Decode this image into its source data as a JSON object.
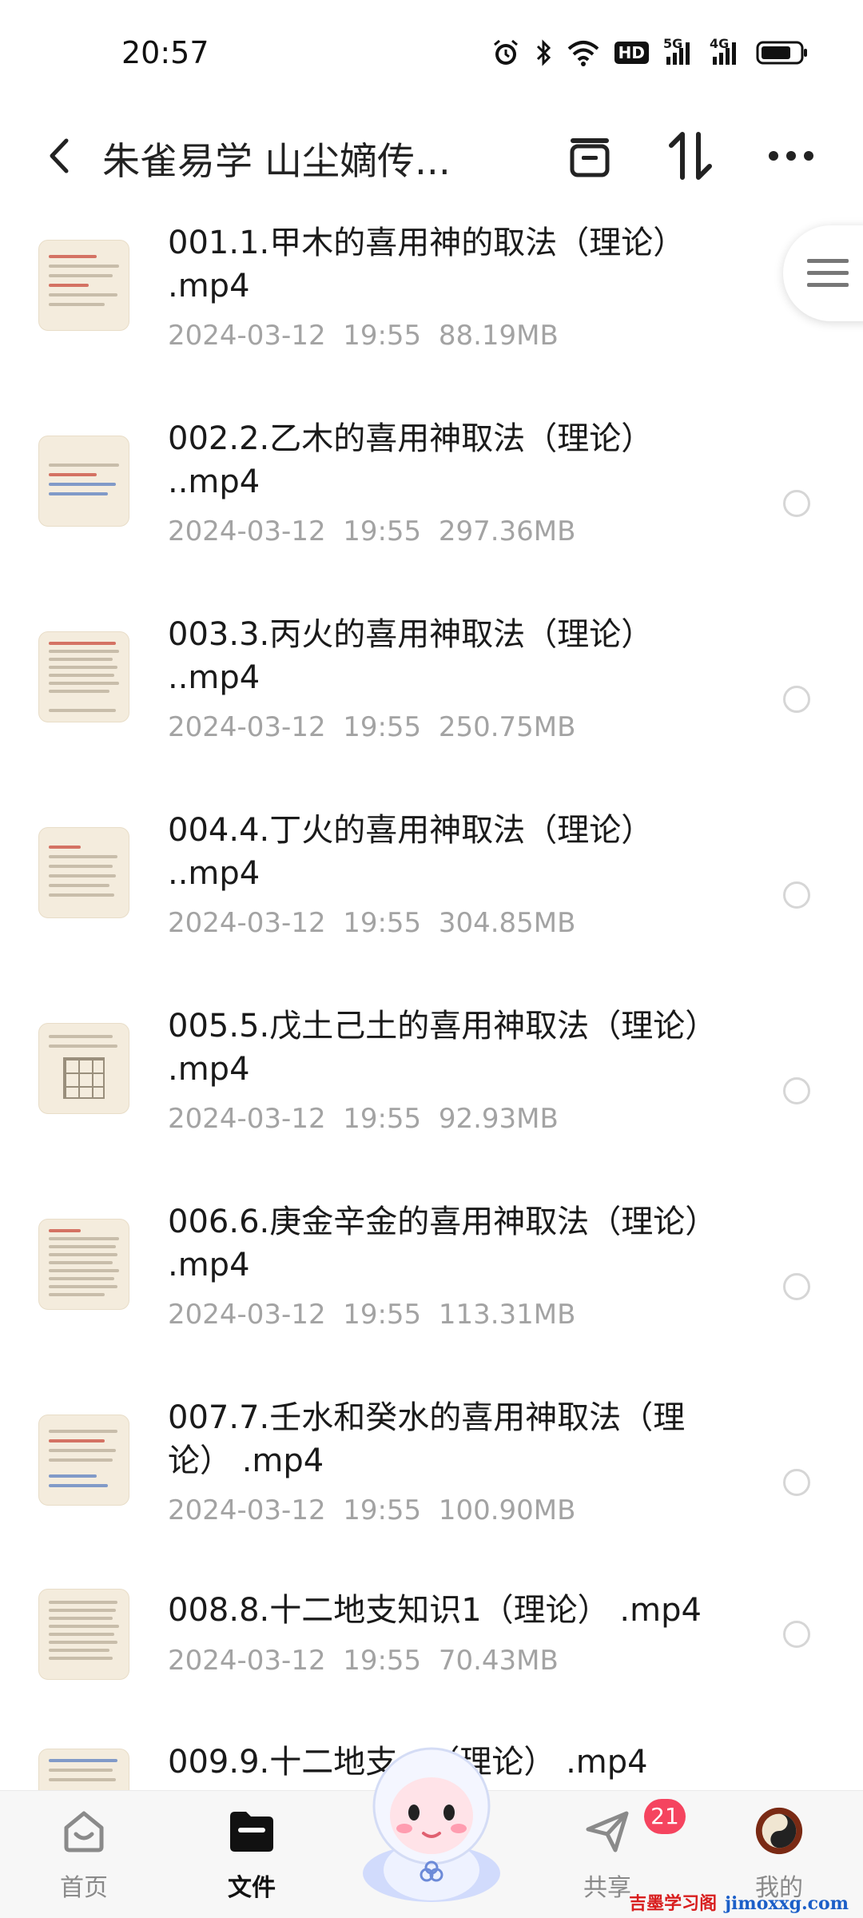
{
  "status_bar": {
    "time": "20:57",
    "icons": [
      "alarm-icon",
      "bluetooth-icon",
      "wifi-icon",
      "hd-icon",
      "signal-5g-icon",
      "signal-4g-icon",
      "battery-icon"
    ],
    "hd_label": "HD",
    "net1": "5G",
    "net2": "4G"
  },
  "header": {
    "title": "朱雀易学 山尘嫡传...",
    "icons": [
      "back-icon",
      "multi-select-icon",
      "sort-icon",
      "more-icon"
    ]
  },
  "files": [
    {
      "name": "001.1.甲木的喜用神的取法（理论） .mp4",
      "date": "2024-03-12  19:55",
      "size": "88.19MB"
    },
    {
      "name": "002.2.乙木的喜用神取法（理论） ..mp4",
      "date": "2024-03-12  19:55",
      "size": "297.36MB"
    },
    {
      "name": "003.3.丙火的喜用神取法（理论） ..mp4",
      "date": "2024-03-12  19:55",
      "size": "250.75MB"
    },
    {
      "name": "004.4.丁火的喜用神取法（理论） ..mp4",
      "date": "2024-03-12  19:55",
      "size": "304.85MB"
    },
    {
      "name": "005.5.戊土己土的喜用神取法（理论） .mp4",
      "date": "2024-03-12  19:55",
      "size": "92.93MB"
    },
    {
      "name": "006.6.庚金辛金的喜用神取法（理论） .mp4",
      "date": "2024-03-12  19:55",
      "size": "113.31MB"
    },
    {
      "name": "007.7.壬水和癸水的喜用神取法（理论） .mp4",
      "date": "2024-03-12  19:55",
      "size": "100.90MB"
    },
    {
      "name": "008.8.十二地支知识1（理论） .mp4",
      "date": "2024-03-12  19:55",
      "size": "70.43MB"
    },
    {
      "name": "009.9.十二地支...（理论） .mp4",
      "date": "",
      "size": ""
    }
  ],
  "bottom_nav": {
    "items": [
      {
        "label": "首页",
        "icon": "home-icon"
      },
      {
        "label": "文件",
        "icon": "folder-icon",
        "active": true
      },
      {
        "label": "共享",
        "icon": "share-icon",
        "badge": "21"
      },
      {
        "label": "我的",
        "icon": "avatar-icon"
      }
    ]
  },
  "watermark": {
    "cn": "吉墨学习阁",
    "en": "jimoxxg.com"
  },
  "colors": {
    "accent": "#111111",
    "badge": "#f5445f",
    "meta": "#a3a3a3"
  }
}
